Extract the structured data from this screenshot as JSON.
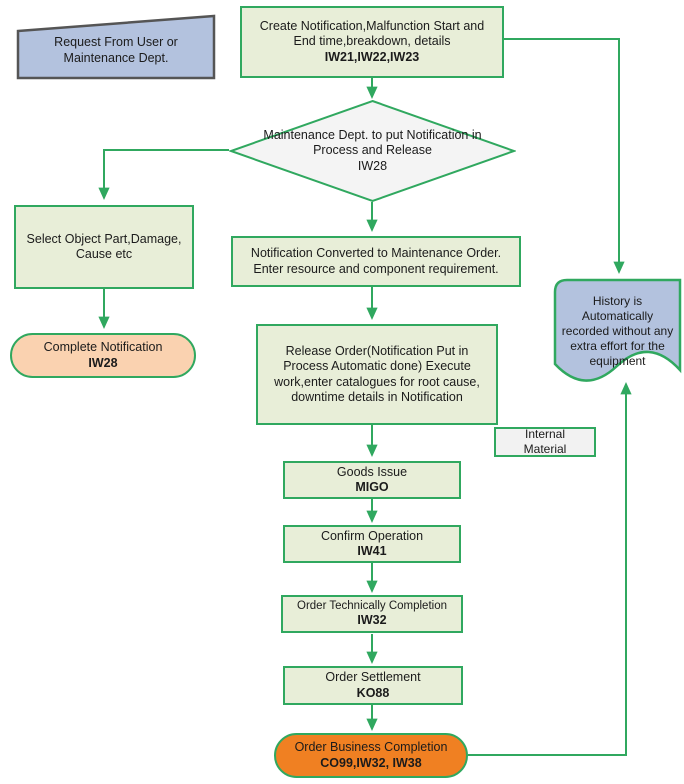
{
  "diagram": {
    "title": "SAP Plant Maintenance Notification and Order Process Flow",
    "colors": {
      "edge": "#30a85f",
      "green_border": "#30a85f",
      "green_fill": "#e8eed8",
      "blue_fill": "#b3c2de",
      "blue_border": "#555555",
      "peach_fill": "#fad2b0",
      "orange_fill": "#f08022",
      "plain_fill": "#f2f2f2",
      "text": "#1b1b1b",
      "background": "#ffffff"
    }
  },
  "nodes": {
    "request": {
      "shape": "trapezoid",
      "line1": "Request From User or",
      "line2": "Maintenance Dept."
    },
    "create_notification": {
      "shape": "process",
      "line1": "Create Notification,Malfunction Start and",
      "line2": "End time,breakdown, details",
      "code": "IW21,IW22,IW23"
    },
    "decision_release": {
      "shape": "decision",
      "line1": "Maintenance Dept. to put Notification in",
      "line2": "Process and Release",
      "code": "IW28"
    },
    "select_object_part": {
      "shape": "process",
      "line1": "Select Object Part,Damage,",
      "line2": "Cause etc"
    },
    "complete_notification": {
      "shape": "terminator",
      "line1": "Complete Notification",
      "code": "IW28"
    },
    "notification_converted": {
      "shape": "process",
      "line1": "Notification Converted to Maintenance Order.",
      "line2": "Enter resource and component requirement."
    },
    "release_order": {
      "shape": "process",
      "line1": "Release Order(Notification Put in",
      "line2": "Process Automatic done) Execute",
      "line3": "work,enter catalogues for root cause,",
      "line4": "downtime details in Notification"
    },
    "internal_material": {
      "shape": "process",
      "line1": "Internal",
      "line2": "Material"
    },
    "history": {
      "shape": "document",
      "line1": "History is",
      "line2": "Automatically",
      "line3": "recorded without any",
      "line4": "extra effort for the",
      "line5": "equipment"
    },
    "goods_issue": {
      "shape": "process",
      "line1": "Goods Issue",
      "code": "MIGO"
    },
    "confirm_operation": {
      "shape": "process",
      "line1": "Confirm Operation",
      "code": "IW41"
    },
    "order_technically_completion": {
      "shape": "process",
      "line1": "Order Technically Completion",
      "code": "IW32"
    },
    "order_settlement": {
      "shape": "process",
      "line1": "Order Settlement",
      "code": "KO88"
    },
    "order_business_completion": {
      "shape": "terminator",
      "line1": "Order Business Completion",
      "code": "CO99,IW32, IW38"
    }
  },
  "edges": [
    {
      "from": "create_notification",
      "to": "decision_release"
    },
    {
      "from": "create_notification",
      "to": "history"
    },
    {
      "from": "decision_release",
      "to": "select_object_part"
    },
    {
      "from": "decision_release",
      "to": "notification_converted"
    },
    {
      "from": "select_object_part",
      "to": "complete_notification"
    },
    {
      "from": "notification_converted",
      "to": "release_order"
    },
    {
      "from": "release_order",
      "to": "goods_issue"
    },
    {
      "from": "goods_issue",
      "to": "confirm_operation"
    },
    {
      "from": "confirm_operation",
      "to": "order_technically_completion"
    },
    {
      "from": "order_technically_completion",
      "to": "order_settlement"
    },
    {
      "from": "order_settlement",
      "to": "order_business_completion"
    },
    {
      "from": "order_business_completion",
      "to": "history"
    }
  ]
}
